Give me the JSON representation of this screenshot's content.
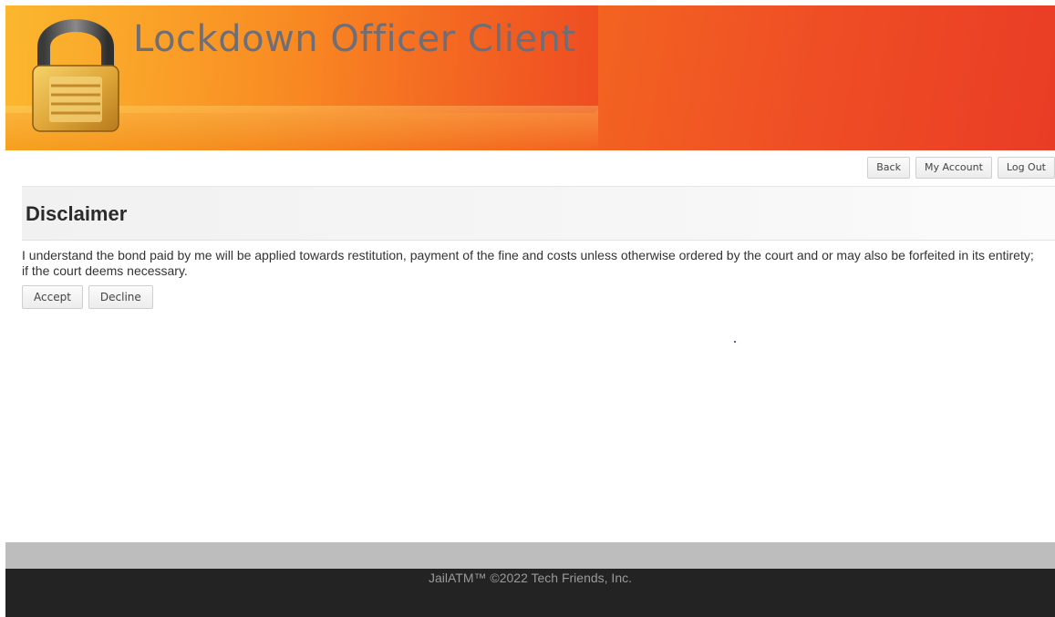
{
  "header": {
    "app_title": "Lockdown Officer Client",
    "logo_icon": "padlock-icon"
  },
  "nav": {
    "back_label": "Back",
    "my_account_label": "My Account",
    "log_out_label": "Log Out"
  },
  "disclaimer": {
    "title": "Disclaimer",
    "text": "I understand the bond paid by me will be applied towards restitution, payment of the fine and costs unless otherwise ordered by the court and or may also be forfeited in its entirety; if the court deems necessary.",
    "accept_label": "Accept",
    "decline_label": "Decline"
  },
  "footer": {
    "copyright": "JailATM™ ©2022 Tech Friends, Inc."
  },
  "colors": {
    "banner_start": "#f7a21e",
    "banner_end": "#e93c25",
    "title_text": "#6e6e78",
    "footer_dark": "#232323",
    "footer_gray": "#bdbdbd"
  }
}
